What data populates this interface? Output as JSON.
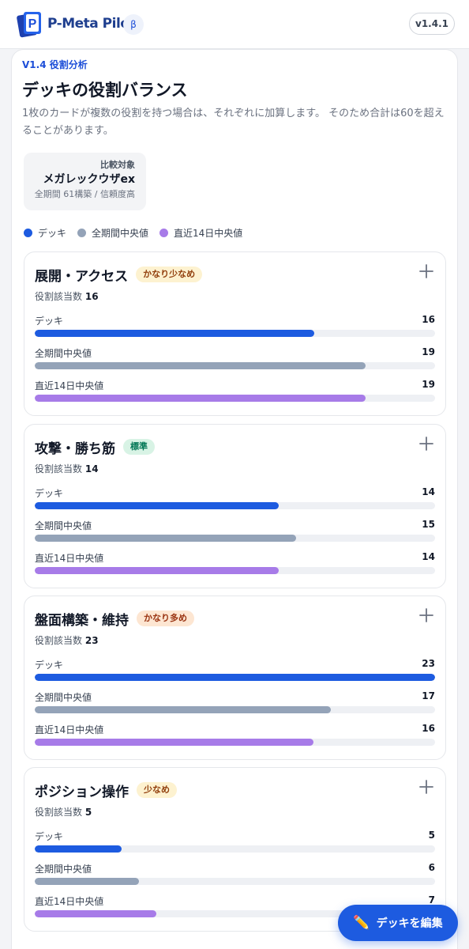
{
  "header": {
    "logo_text": "P-Meta Pilot",
    "beta_label": "β",
    "version": "v1.4.1"
  },
  "section": {
    "eyebrow": "V1.4 役割分析",
    "title": "デッキの役割バランス",
    "description": "1枚のカードが複数の役割を持つ場合は、それぞれに加算します。 そのため合計は60を超えることがあります。"
  },
  "comparison": {
    "label": "比較対象",
    "name": "メガレックウザex",
    "meta": "全期間 61構築 / 信頼度高"
  },
  "legend": [
    {
      "label": "デッキ",
      "color": "#1d5be0"
    },
    {
      "label": "全期間中央値",
      "color": "#94a3b8"
    },
    {
      "label": "直近14日中央値",
      "color": "#a77be8"
    }
  ],
  "roles": [
    {
      "title": "展開・アクセス",
      "badge": "かなり少なめ",
      "badge_type": "low",
      "count_label": "役割該当数",
      "count": "16",
      "rows": [
        {
          "label": "デッキ",
          "value": "16",
          "fraction": 0.698
        },
        {
          "label": "全期間中央値",
          "value": "19",
          "fraction": 0.826
        },
        {
          "label": "直近14日中央値",
          "value": "19",
          "fraction": 0.826
        }
      ]
    },
    {
      "title": "攻撃・勝ち筋",
      "badge": "標準",
      "badge_type": "ok",
      "count_label": "役割該当数",
      "count": "14",
      "rows": [
        {
          "label": "デッキ",
          "value": "14",
          "fraction": 0.609
        },
        {
          "label": "全期間中央値",
          "value": "15",
          "fraction": 0.652
        },
        {
          "label": "直近14日中央値",
          "value": "14",
          "fraction": 0.609
        }
      ]
    },
    {
      "title": "盤面構築・維持",
      "badge": "かなり多め",
      "badge_type": "high",
      "count_label": "役割該当数",
      "count": "23",
      "rows": [
        {
          "label": "デッキ",
          "value": "23",
          "fraction": 1.0
        },
        {
          "label": "全期間中央値",
          "value": "17",
          "fraction": 0.739
        },
        {
          "label": "直近14日中央値",
          "value": "16",
          "fraction": 0.696
        }
      ]
    },
    {
      "title": "ポジション操作",
      "badge": "少なめ",
      "badge_type": "low",
      "count_label": "役割該当数",
      "count": "5",
      "rows": [
        {
          "label": "デッキ",
          "value": "5",
          "fraction": 0.217
        },
        {
          "label": "全期間中央値",
          "value": "6",
          "fraction": 0.261
        },
        {
          "label": "直近14日中央値",
          "value": "7",
          "fraction": 0.304
        }
      ]
    }
  ],
  "fab": {
    "icon": "pencil-icon",
    "label": "デッキを編集"
  }
}
